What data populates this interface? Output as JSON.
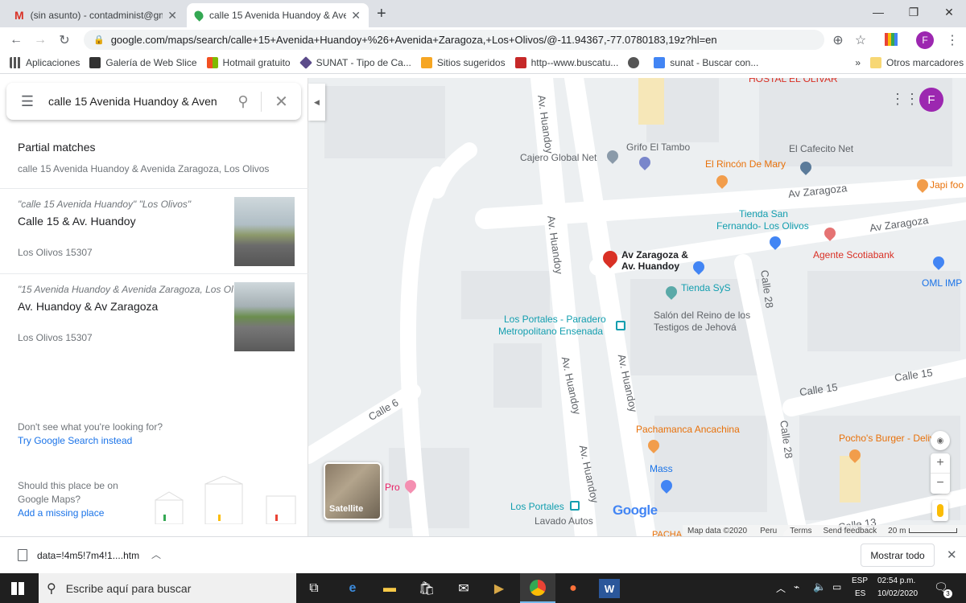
{
  "browser": {
    "tabs": [
      {
        "title": "(sin asunto) - contadminist@gm"
      },
      {
        "title": "calle 15 Avenida Huandoy & Ave"
      }
    ],
    "url": "google.com/maps/search/calle+15+Avenida+Huandoy+%26+Avenida+Zaragoza,+Los+Olivos/@-11.94367,-77.0780183,19z?hl=en",
    "bookmarks": [
      "Aplicaciones",
      "Galería de Web Slice",
      "Hotmail gratuito",
      "SUNAT - Tipo de Ca...",
      "Sitios sugeridos",
      "http--www.buscatu...",
      "sunat - Buscar con...",
      "»",
      "Otros marcadores"
    ]
  },
  "panel": {
    "query": "calle 15 Avenida Huandoy & Aven",
    "partial_title": "Partial matches",
    "partial_sub": "calle 15 Avenida Huandoy & Avenida Zaragoza, Los Olivos",
    "results": [
      {
        "query": "\"calle 15 Avenida Huandoy\" \"Los Olivos\"",
        "title": "Calle 15 & Av. Huandoy",
        "address": "Los Olivos 15307"
      },
      {
        "query": "\"15 Avenida Huandoy & Avenida Zaragoza, Los Oli",
        "title": "Av. Huandoy & Av Zaragoza",
        "address": "Los Olivos 15307"
      }
    ],
    "dont_see": "Don't see what you're looking for?",
    "try_search": "Try Google Search instead",
    "should_this": "Should this place be on",
    "google_maps": "Google Maps?",
    "add_missing": "Add a missing place"
  },
  "map": {
    "labels": {
      "hostal": "HOSTAL EL OLIVAR",
      "huandoy_top": "Av. Huandoy",
      "cajero": "Cajero Global Net",
      "grifo": "Grifo El Tambo",
      "cafecito": "El Cafecito Net",
      "rincon": "El Rincón De Mary",
      "zaragoza1": "Av Zaragoza",
      "japi": "Japi foo",
      "tienda_san1": "Tienda San",
      "tienda_san2": "Fernando- Los Olivos",
      "zaragoza2": "Av Zaragoza",
      "huandoy_mid": "Av. Huandoy",
      "pin_label1": "Av Zaragoza &",
      "pin_label2": "Av. Huandoy",
      "scotia": "Agente Scotiabank",
      "oml": "OML IMP",
      "calle28a": "Calle 28",
      "tienda_sys": "Tienda SyS",
      "salon1": "Salón del Reino de los",
      "salon2": "Testigos de Jehová",
      "portales1": "Los Portales - Paradero",
      "portales2": "Metropolitano Ensenada",
      "huandoy_l": "Av. Huandoy",
      "huandoy_r": "Av. Huandoy",
      "calle15a": "Calle 15",
      "calle15b": "Calle 15",
      "calle6": "Calle 6",
      "pachamanca": "Pachamanca Ancachina",
      "calle28b": "Calle 28",
      "pochos": "Pocho's Burger - Delivery",
      "huandoy_bottom": "Av. Huandoy",
      "mass": "Mass",
      "pro": "Pro",
      "portales3": "Los Portales",
      "lavado": "Lavado Autos",
      "calle13": "Calle 13",
      "pacha2": "PACHA"
    },
    "satellite": "Satellite",
    "google": "Google",
    "footer": {
      "data": "Map data ©2020",
      "peru": "Peru",
      "terms": "Terms",
      "feedback": "Send feedback",
      "scale": "20 m"
    },
    "avatar": "F"
  },
  "download": {
    "file": "data=!4m5!7m4!1....htm",
    "show_all": "Mostrar todo"
  },
  "taskbar": {
    "search": "Escribe aquí para buscar",
    "lang1": "ESP",
    "lang2": "ES",
    "time": "02:54 p.m.",
    "date": "10/02/2020",
    "notif": "3"
  },
  "colors": {
    "accent": "#1a73e8",
    "pin": "#d93025",
    "avatar": "#9c27b0"
  }
}
